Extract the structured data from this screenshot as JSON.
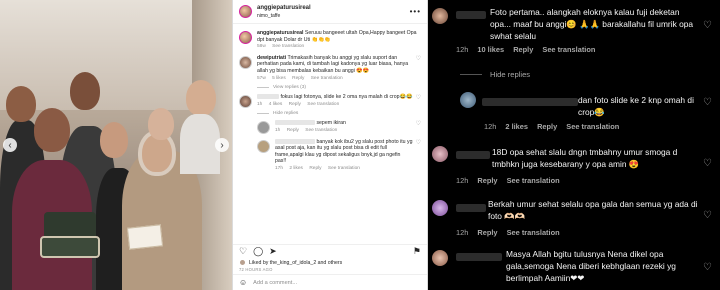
{
  "post": {
    "username": "anggiepaturusireal",
    "location": "nimo_taffe",
    "more_icon": "more-horizontal-icon",
    "comments": [
      {
        "user": "anggiepaturusireal",
        "text": "Seruuu bangeeet ultah Opa,Happy bangeet Opa dpt banyak Dolar dr Uti 👏👏👏",
        "meta": [
          "58w",
          "See translation"
        ]
      },
      {
        "user": "dewiputriati",
        "text": "Trimakasih banyak bu anggi yg slalu suport dan perhatian pada kami, di tambah lagi kadonya yg luar biasa, hanya allah yg bisa membalas kebaikan bu anggi 😍😍",
        "meta": [
          "57w",
          "5 likes",
          "Reply",
          "See translation"
        ],
        "view_replies": "View replies (3)"
      },
      {
        "user": "",
        "text": "fokus lagi fotonya, slide ke 2 oma nya malah di crop😂😂",
        "meta": [
          "1h",
          "4 likes",
          "Reply",
          "See translation"
        ],
        "hide_replies": "Hide replies",
        "replies": [
          {
            "user": "",
            "text": "sepem ikiran",
            "meta": [
              "1h",
              "Reply",
              "See translation"
            ]
          },
          {
            "user": "",
            "text": "banyak kok ibu2 yg slalu post photo itu yg asal post aja, kan itu yg slalu post bisa di edit full frame,apalgi klau yg dipost sekaligus bnyk,jd ga ngefin pas!!",
            "meta": [
              "17h",
              "2 likes",
              "Reply",
              "See translation"
            ]
          }
        ]
      }
    ],
    "likes_text": "Liked by the_king_of_idola_2 and others",
    "time_ago": "72 HOURS AGO",
    "add_comment_placeholder": "Add a comment..."
  },
  "dark_comments": [
    {
      "text": "Foto pertama.. alangkah eloknya kalau fuji deketan opa... maaf bu anggi😊 🙏🙏 barakallahu fil umrik opa swhat selalu",
      "time": "12h",
      "likes": "10 likes",
      "reply": "Reply",
      "translate": "See translation"
    },
    {
      "hide": "Hide replies"
    },
    {
      "text": "dan foto slide ke 2 knp omah di crop😂",
      "time": "12h",
      "likes": "2 likes",
      "reply": "Reply",
      "translate": "See translation"
    },
    {
      "text": "18D opa sehat slalu dngn tmbahny umur smoga d tmbhkn juga kesebarany y opa amin 😍",
      "time": "12h",
      "reply": "Reply",
      "translate": "See translation"
    },
    {
      "text": "Berkah umur sehat selalu opa gala dan semua yg ada di foto 🫶🏻🫶🏻",
      "time": "12h",
      "reply": "Reply",
      "translate": "See translation"
    },
    {
      "text": "Masya Allah bgitu tulusnya Nena dikel opa gala,semoga Nena diberi kebhglaan rezeki yg berlimpah Aamiin❤❤",
      "time": "12h",
      "reply": "Reply",
      "translate": "See translation"
    }
  ],
  "colors": {
    "dark_bg": "#000000",
    "dark_text": "#f5f5f5",
    "muted": "#a8a8a8"
  }
}
